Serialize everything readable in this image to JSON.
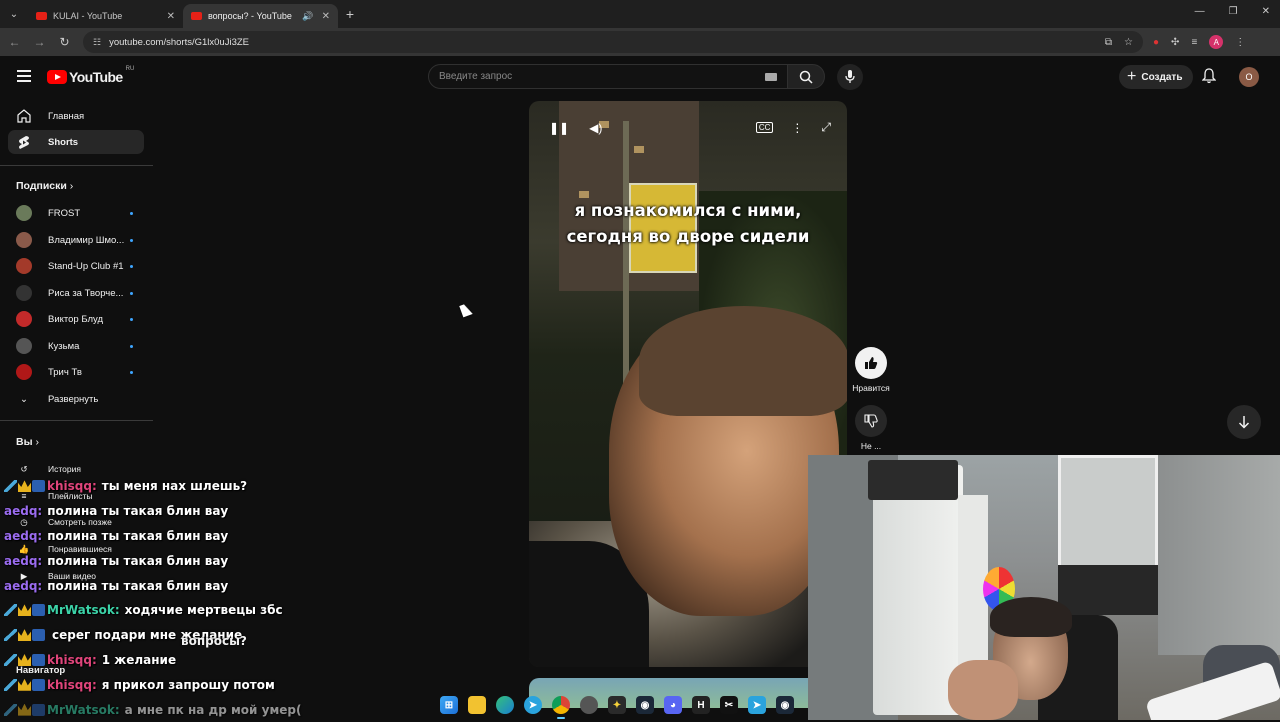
{
  "browser": {
    "tabs": [
      {
        "title": "KULAI - YouTube",
        "active": false
      },
      {
        "title": "вопросы? - YouTube",
        "active": true
      }
    ],
    "url": "youtube.com/shorts/G1lx0uJi3ZE",
    "profile_initial": "A"
  },
  "youtube": {
    "region": "RU",
    "logo_text": "YouTube",
    "search_placeholder": "Введите запрос",
    "create_label": "Создать",
    "avatar_initial": "O"
  },
  "sidebar": {
    "main": [
      {
        "label": "Главная",
        "icon": "home-icon"
      },
      {
        "label": "Shorts",
        "icon": "shorts-icon",
        "active": true
      }
    ],
    "subscriptions_header": "Подписки",
    "subscriptions": [
      {
        "name": "FROST",
        "color": "#6a7a5a"
      },
      {
        "name": "Владимир Шмо...",
        "color": "#8a5a4a"
      },
      {
        "name": "Stand-Up Club #1",
        "color": "#a33a2a"
      },
      {
        "name": "Риса за Творче...",
        "color": "#333333"
      },
      {
        "name": "Виктор Блуд",
        "color": "#c22a2a"
      },
      {
        "name": "Кузьма",
        "color": "#555555"
      },
      {
        "name": "Трич Тв",
        "color": "#b01818"
      }
    ],
    "expand_label": "Развернуть",
    "you_header": "Вы",
    "you_items": [
      "История",
      "Плейлисты",
      "Смотреть позже",
      "Понравившиеся",
      "Ваши видео"
    ],
    "navigator_label": "Навигатор"
  },
  "short": {
    "caption_line1": "я познакомился с ними,",
    "caption_line2": "сегодня во дворе сидели",
    "like_label": "Нравится",
    "dislike_label": "Не ..."
  },
  "chat": [
    {
      "nick": "khisqq:",
      "nick_color": "#e0457b",
      "msg": "ты меня нах шлешь?",
      "badges": true
    },
    {
      "nick": "aedq:",
      "nick_color": "#9b6cf0",
      "msg": "полина ты такая блин вау",
      "badges": false
    },
    {
      "nick": "aedq:",
      "nick_color": "#9b6cf0",
      "msg": "полина ты такая блин вау",
      "badges": false
    },
    {
      "nick": "aedq:",
      "nick_color": "#9b6cf0",
      "msg": "полина ты такая блин вау",
      "badges": false
    },
    {
      "nick": "aedq:",
      "nick_color": "#9b6cf0",
      "msg": "полина ты такая блин вау",
      "badges": false
    },
    {
      "nick": "MrWatsok:",
      "nick_color": "#3cd3a8",
      "msg": "ходячие мертвецы збс",
      "badges": true
    },
    {
      "nick": "",
      "nick_color": "#e0457b",
      "msg": "серег подари мне желание",
      "badges": true
    },
    {
      "nick": "khisqq:",
      "nick_color": "#e0457b",
      "msg": "1 желание",
      "badges": true
    },
    {
      "nick": "khisqq:",
      "nick_color": "#e0457b",
      "msg": "я прикол запрошу потом",
      "badges": true
    },
    {
      "nick": "MrWatsok:",
      "nick_color": "#3cd3a8",
      "msg": "а мне пк на др мой умер(",
      "badges": true,
      "faded": true
    }
  ],
  "chat_overlay_text": "вопросы?"
}
